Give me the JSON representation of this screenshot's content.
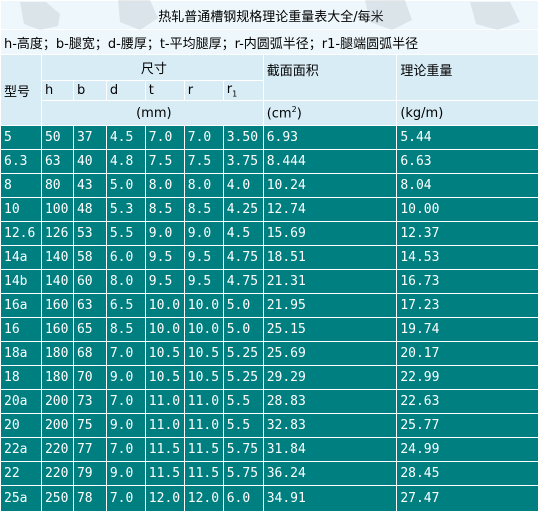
{
  "title": "热轧普通槽钢规格理论重量表大全/每米",
  "legend": "h-高度；b-腿宽；d-腰厚；t-平均腿厚；r-内圆弧半径；r1-腿端圆弧半径",
  "headers": {
    "model": "型号",
    "size": "尺寸",
    "cols": [
      "h",
      "b",
      "d",
      "t",
      "r",
      "r"
    ],
    "r1_sub": "1",
    "size_unit": "(mm)",
    "area": "截面面积",
    "area_unit": "(cm",
    "area_unit_sup": "2",
    "area_unit_close": ")",
    "weight": "理论重量",
    "weight_unit": "(kg/m)"
  },
  "rows": [
    [
      "5",
      "50",
      "37",
      "4.5",
      "7.0",
      "7.0",
      "3.50",
      "6.93",
      "5.44"
    ],
    [
      "6.3",
      "63",
      "40",
      "4.8",
      "7.5",
      "7.5",
      "3.75",
      "8.444",
      "6.63"
    ],
    [
      "8",
      "80",
      "43",
      "5.0",
      "8.0",
      "8.0",
      "4.0",
      "10.24",
      "8.04"
    ],
    [
      "10",
      "100",
      "48",
      "5.3",
      "8.5",
      "8.5",
      "4.25",
      "12.74",
      "10.00"
    ],
    [
      "12.6",
      "126",
      "53",
      "5.5",
      "9.0",
      "9.0",
      "4.5",
      "15.69",
      "12.37"
    ],
    [
      "14a",
      "140",
      "58",
      "6.0",
      "9.5",
      "9.5",
      "4.75",
      "18.51",
      "14.53"
    ],
    [
      "14b",
      "140",
      "60",
      "8.0",
      "9.5",
      "9.5",
      "4.75",
      "21.31",
      "16.73"
    ],
    [
      "16a",
      "160",
      "63",
      "6.5",
      "10.0",
      "10.0",
      "5.0",
      "21.95",
      "17.23"
    ],
    [
      "16",
      "160",
      "65",
      "8.5",
      "10.0",
      "10.0",
      "5.0",
      "25.15",
      "19.74"
    ],
    [
      "18a",
      "180",
      "68",
      "7.0",
      "10.5",
      "10.5",
      "5.25",
      "25.69",
      "20.17"
    ],
    [
      "18",
      "180",
      "70",
      "9.0",
      "10.5",
      "10.5",
      "5.25",
      "29.29",
      "22.99"
    ],
    [
      "20a",
      "200",
      "73",
      "7.0",
      "11.0",
      "11.0",
      "5.5",
      "28.83",
      "22.63"
    ],
    [
      "20",
      "200",
      "75",
      "9.0",
      "11.0",
      "11.0",
      "5.5",
      "32.83",
      "25.77"
    ],
    [
      "22a",
      "220",
      "77",
      "7.0",
      "11.5",
      "11.5",
      "5.75",
      "31.84",
      "24.99"
    ],
    [
      "22",
      "220",
      "79",
      "9.0",
      "11.5",
      "11.5",
      "5.75",
      "36.24",
      "28.45"
    ],
    [
      "25a",
      "250",
      "78",
      "7.0",
      "12.0",
      "12.0",
      "6.0",
      "34.91",
      "27.47"
    ]
  ],
  "colors": {
    "data_bg": "#007f80",
    "header_bg": "#d8ecf6",
    "title_bg": "#eef7fb",
    "data_text": "#ffffff"
  }
}
